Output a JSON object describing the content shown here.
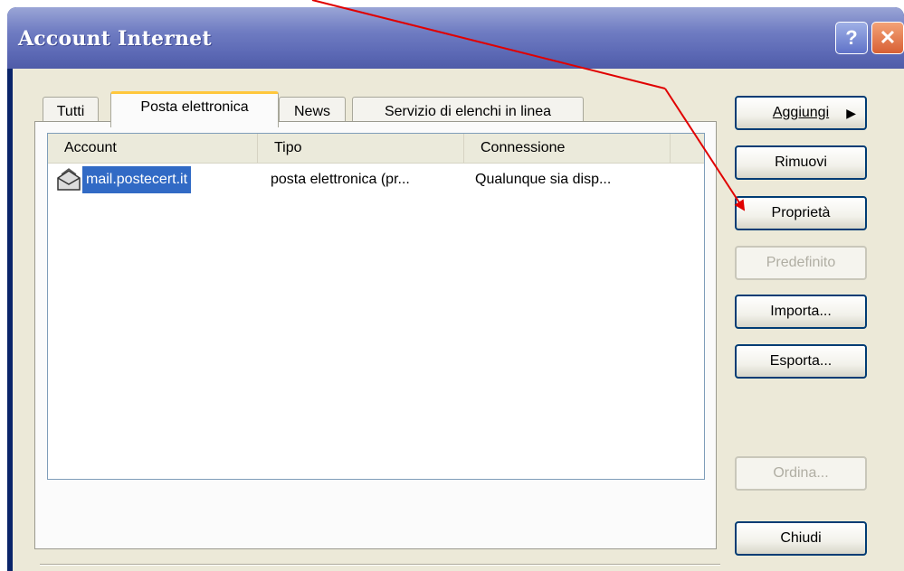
{
  "window": {
    "title": "Account Internet"
  },
  "titlebar": {
    "help_label": "?",
    "close_label": "✕"
  },
  "tabs": [
    {
      "label": "Tutti"
    },
    {
      "label": "Posta elettronica"
    },
    {
      "label": "News"
    },
    {
      "label": "Servizio di elenchi in linea"
    }
  ],
  "list": {
    "columns": [
      "Account",
      "Tipo",
      "Connessione"
    ],
    "rows": [
      {
        "account": "mail.postecert.it",
        "tipo": "posta elettronica (pr...",
        "connessione": "Qualunque sia disp..."
      }
    ]
  },
  "buttons": {
    "aggiungi": "Aggiungi",
    "rimuovi": "Rimuovi",
    "proprieta": "Proprietà",
    "predefinito": "Predefinito",
    "importa": "Importa...",
    "esporta": "Esporta...",
    "ordina": "Ordina...",
    "chiudi": "Chiudi"
  },
  "annotation": {
    "arrow_color": "#e00000",
    "points_to": "Proprietà"
  }
}
